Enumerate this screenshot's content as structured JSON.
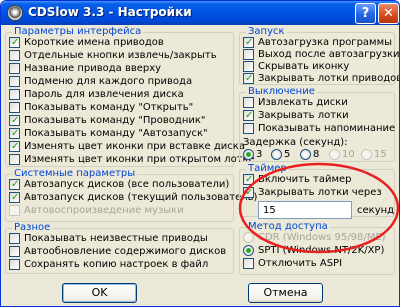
{
  "window": {
    "title": "CDSlow 3.3 - Настройки",
    "help_label": "?",
    "close_label": "✕"
  },
  "interface": {
    "legend": "Параметры интерфейса",
    "items": [
      {
        "label": "Короткие имена приводов",
        "checked": true
      },
      {
        "label": "Отдельные кнопки извлечь/закрыть",
        "checked": false
      },
      {
        "label": "Название привода вверху",
        "checked": false
      },
      {
        "label": "Подменю для каждого привода",
        "checked": false
      },
      {
        "label": "Пароль для извлечения диска",
        "checked": false
      },
      {
        "label": "Показывать команду \"Открыть\"",
        "checked": false
      },
      {
        "label": "Показывать команду \"Проводник\"",
        "checked": true
      },
      {
        "label": "Показывать команду \"Автозапуск\"",
        "checked": true
      },
      {
        "label": "Изменять цвет иконки при вставке диска",
        "checked": true
      },
      {
        "label": "Изменять цвет иконки при открытом лотке",
        "checked": false
      }
    ]
  },
  "system": {
    "legend": "Системные параметры",
    "items": [
      {
        "label": "Автозапуск дисков (все пользователи)",
        "checked": true
      },
      {
        "label": "Автозапуск дисков (текущий пользователь)",
        "checked": true
      },
      {
        "label": "Автовоспроизведение музыки",
        "checked": false,
        "disabled": true
      }
    ]
  },
  "misc": {
    "legend": "Разное",
    "items": [
      {
        "label": "Показывать неизвестные приводы",
        "checked": false
      },
      {
        "label": "Автообновление содержимого дисков",
        "checked": false
      },
      {
        "label": "Сохранять копию настроек в файл",
        "checked": false
      }
    ]
  },
  "startup": {
    "legend": "Запуск",
    "items": [
      {
        "label": "Автозагрузка программы",
        "checked": true
      },
      {
        "label": "Выход после автозагрузки",
        "checked": false
      },
      {
        "label": "Скрывать иконку",
        "checked": false
      },
      {
        "label": "Закрывать лотки приводов",
        "checked": true
      }
    ]
  },
  "shutdown": {
    "legend": "Выключение",
    "items": [
      {
        "label": "Извлекать диски",
        "checked": false
      },
      {
        "label": "Закрывать лотки",
        "checked": true
      },
      {
        "label": "Показывать напоминание",
        "checked": false
      }
    ],
    "delay_label": "Задержка (секунд):",
    "delay_options": [
      {
        "label": "3",
        "selected": true,
        "disabled": false
      },
      {
        "label": "5",
        "selected": false,
        "disabled": false
      },
      {
        "label": "8",
        "selected": false,
        "disabled": false
      },
      {
        "label": "10",
        "selected": false,
        "disabled": true
      },
      {
        "label": "15",
        "selected": false,
        "disabled": true
      }
    ]
  },
  "timer": {
    "legend": "Таймер",
    "items": [
      {
        "label": "Включить таймер",
        "checked": true
      },
      {
        "label": "Закрывать лотки через",
        "checked": true
      }
    ],
    "value": "15",
    "unit": "секунд"
  },
  "access": {
    "legend": "Метод доступа",
    "options": [
      {
        "label": "CDR (Windows 95/98/ME)",
        "selected": false,
        "disabled": true
      },
      {
        "label": "SPTI (Windows NT/2K/XP)",
        "selected": true,
        "disabled": false
      }
    ],
    "disable_aspi": {
      "label": "Отключить ASPI",
      "checked": false
    }
  },
  "buttons": {
    "ok": "OK",
    "cancel": "Отмена"
  },
  "colors": {
    "accent": "#0046d5",
    "titlebar": "#0055e5",
    "annotation": "#e8201e"
  }
}
